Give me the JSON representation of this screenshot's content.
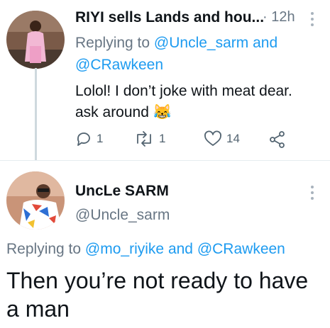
{
  "tweet1": {
    "author_name": "RIYI sells Lands and hou...",
    "time": "· 12h",
    "replying_prefix": "Replying to",
    "mention_1": "@Uncle_sarm",
    "and_word": "and",
    "mention_2": "@CRawkeen",
    "text": "Lolol! I don’t joke with meat dear. ask around",
    "emoji": "😹",
    "reply_count": "1",
    "retweet_count": "1",
    "like_count": "14"
  },
  "tweet2": {
    "author_name": "UncLe SARM",
    "handle": "@Uncle_sarm",
    "replying_prefix": "Replying to",
    "mention_1": "@mo_riyike",
    "and_word": "and",
    "mention_2": "@CRawkeen",
    "text": "Then you’re not ready to have a man"
  },
  "colors": {
    "accent": "#1d9bf0",
    "muted": "#687684",
    "thread_line": "#cfd9de"
  },
  "icons": [
    "reply-icon",
    "retweet-icon",
    "like-icon",
    "share-icon",
    "more-icon"
  ]
}
